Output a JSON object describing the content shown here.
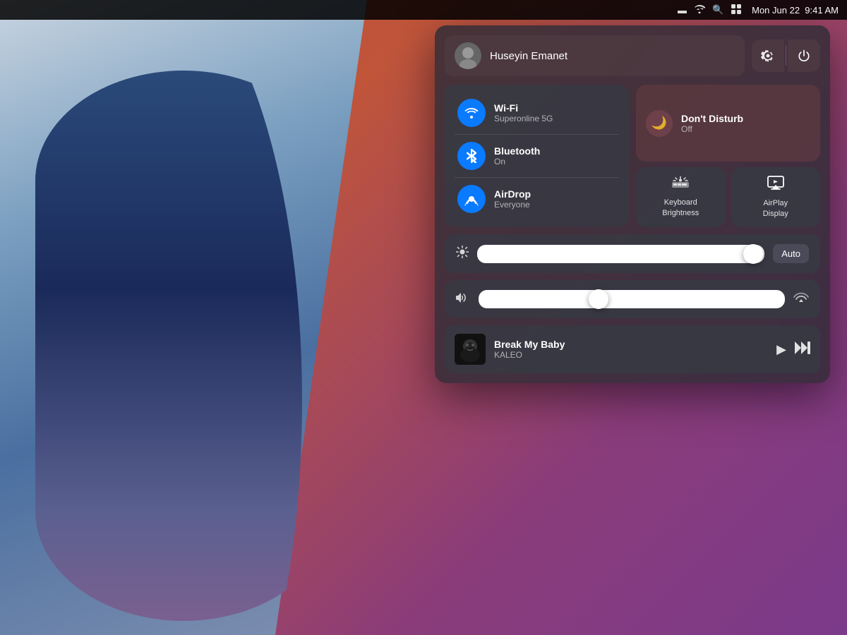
{
  "desktop": {
    "bg_description": "macOS Big Sur wallpaper warm tones"
  },
  "menubar": {
    "time": "9:41 AM",
    "date": "Mon Jun 22",
    "icons": [
      "battery",
      "wifi",
      "search",
      "control-center"
    ]
  },
  "control_center": {
    "user": {
      "name": "Huseyin Emanet",
      "avatar_emoji": "🧔"
    },
    "actions": {
      "settings_label": "⚙",
      "power_label": "⏻"
    },
    "wifi": {
      "title": "Wi-Fi",
      "subtitle": "Superonline 5G",
      "enabled": true
    },
    "bluetooth": {
      "title": "Bluetooth",
      "subtitle": "On",
      "enabled": true
    },
    "airdrop": {
      "title": "AirDrop",
      "subtitle": "Everyone",
      "enabled": true
    },
    "dont_disturb": {
      "title": "Don't Disturb",
      "subtitle": "Off",
      "enabled": false
    },
    "keyboard_brightness": {
      "title": "Keyboard",
      "title2": "Brightness"
    },
    "airplay_display": {
      "title": "AirPlay",
      "title2": "Display"
    },
    "brightness": {
      "label": "Brightness",
      "value": 90,
      "auto_label": "Auto"
    },
    "volume": {
      "label": "Volume",
      "value": 35
    },
    "now_playing": {
      "title": "Break My Baby",
      "artist": "KALEO",
      "play_icon": "▶",
      "skip_icon": "⏭"
    }
  }
}
